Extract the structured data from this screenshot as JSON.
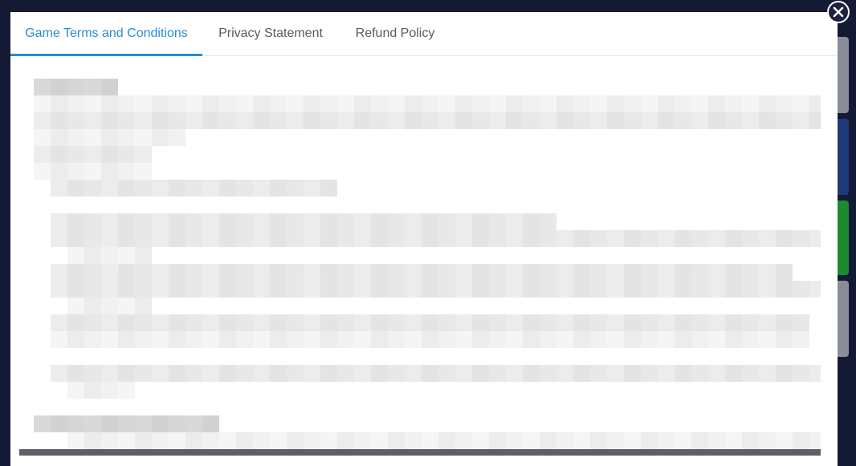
{
  "dialog": {
    "tabs": [
      {
        "label": "Game Terms and Conditions",
        "active": true
      },
      {
        "label": "Privacy Statement",
        "active": false
      },
      {
        "label": "Refund Policy",
        "active": false
      }
    ],
    "close_icon": "close-icon",
    "content_state": "blurred"
  },
  "colors": {
    "backdrop": "#141a33",
    "active_tab": "#2a8bd6",
    "inactive_tab": "#555a64"
  }
}
